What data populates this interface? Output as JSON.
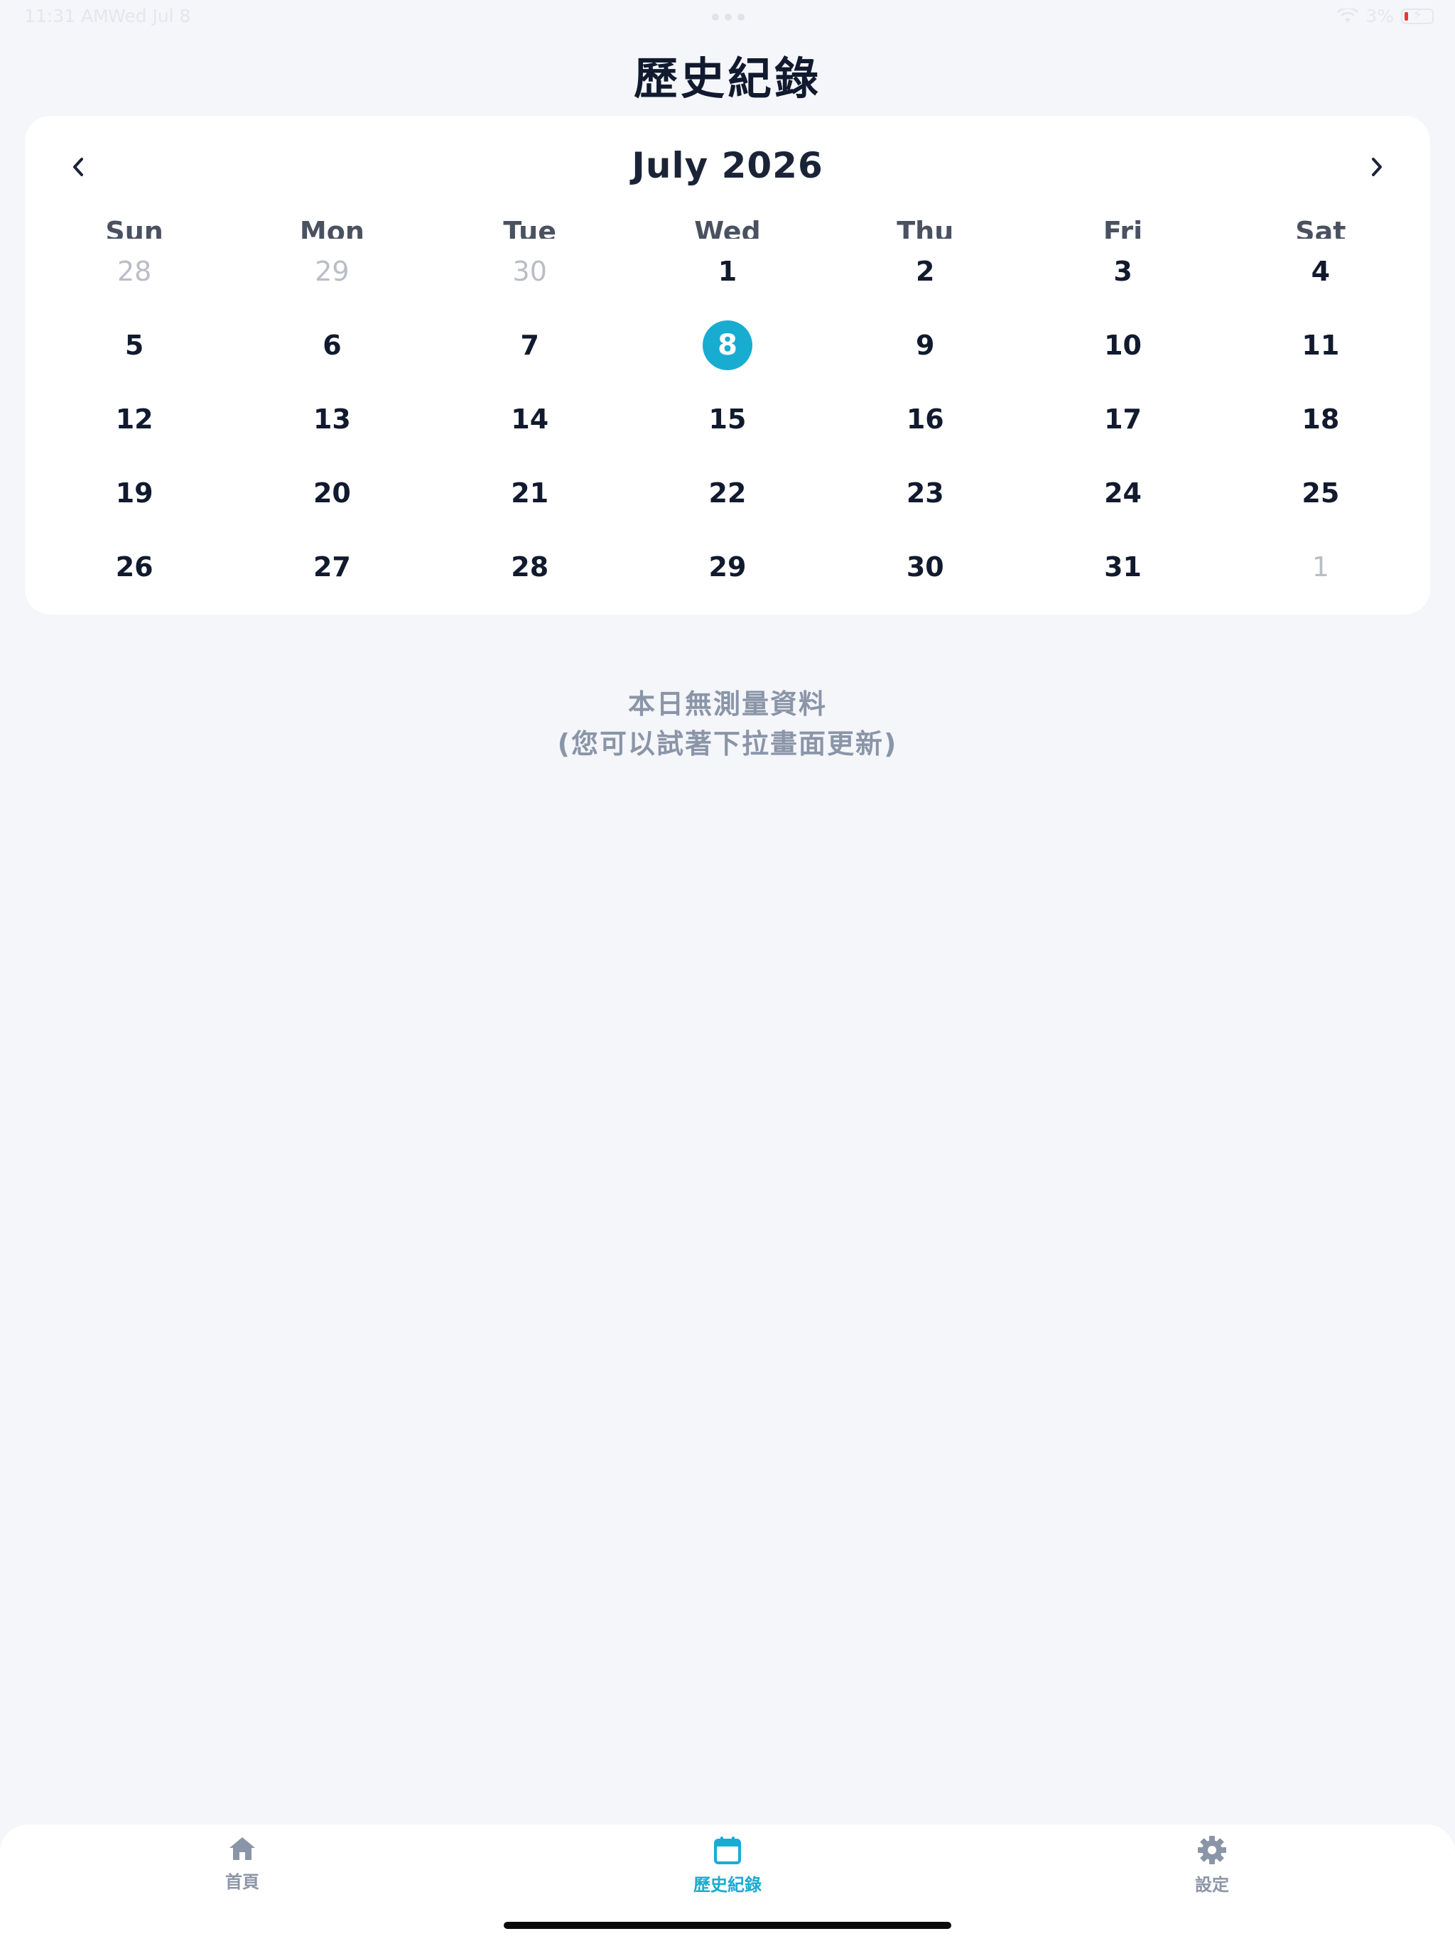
{
  "status_bar": {
    "time": "11:31 AM",
    "date": "Wed Jul 8",
    "battery_percent": "3%",
    "icons": [
      "wifi-icon",
      "battery-icon"
    ]
  },
  "page_title": "歷史紀錄",
  "calendar": {
    "month_label": "July 2026",
    "prev_icon": "chevron-left-icon",
    "next_icon": "chevron-right-icon",
    "weekdays": [
      "Sun",
      "Mon",
      "Tue",
      "Wed",
      "Thu",
      "Fri",
      "Sat"
    ],
    "days": [
      {
        "label": "28",
        "muted": true
      },
      {
        "label": "29",
        "muted": true
      },
      {
        "label": "30",
        "muted": true
      },
      {
        "label": "1",
        "muted": false
      },
      {
        "label": "2",
        "muted": false
      },
      {
        "label": "3",
        "muted": false
      },
      {
        "label": "4",
        "muted": false
      },
      {
        "label": "5",
        "muted": false
      },
      {
        "label": "6",
        "muted": false
      },
      {
        "label": "7",
        "muted": false
      },
      {
        "label": "8",
        "muted": false,
        "selected": true
      },
      {
        "label": "9",
        "muted": false
      },
      {
        "label": "10",
        "muted": false
      },
      {
        "label": "11",
        "muted": false
      },
      {
        "label": "12",
        "muted": false
      },
      {
        "label": "13",
        "muted": false
      },
      {
        "label": "14",
        "muted": false
      },
      {
        "label": "15",
        "muted": false
      },
      {
        "label": "16",
        "muted": false
      },
      {
        "label": "17",
        "muted": false
      },
      {
        "label": "18",
        "muted": false
      },
      {
        "label": "19",
        "muted": false
      },
      {
        "label": "20",
        "muted": false
      },
      {
        "label": "21",
        "muted": false
      },
      {
        "label": "22",
        "muted": false
      },
      {
        "label": "23",
        "muted": false
      },
      {
        "label": "24",
        "muted": false
      },
      {
        "label": "25",
        "muted": false
      },
      {
        "label": "26",
        "muted": false
      },
      {
        "label": "27",
        "muted": false
      },
      {
        "label": "28",
        "muted": false
      },
      {
        "label": "29",
        "muted": false
      },
      {
        "label": "30",
        "muted": false
      },
      {
        "label": "31",
        "muted": false
      },
      {
        "label": "1",
        "muted": true
      }
    ],
    "selected_color": "#18acd1"
  },
  "empty_message": {
    "line1": "本日無測量資料",
    "line2": "(您可以試著下拉畫面更新)"
  },
  "tab_bar": {
    "tabs": [
      {
        "label": "首頁",
        "icon": "home-icon",
        "active": false
      },
      {
        "label": "歷史紀錄",
        "icon": "calendar-icon",
        "active": true
      },
      {
        "label": "設定",
        "icon": "gear-icon",
        "active": false
      }
    ],
    "active_color": "#18acd1",
    "inactive_color": "#8b95a8"
  }
}
